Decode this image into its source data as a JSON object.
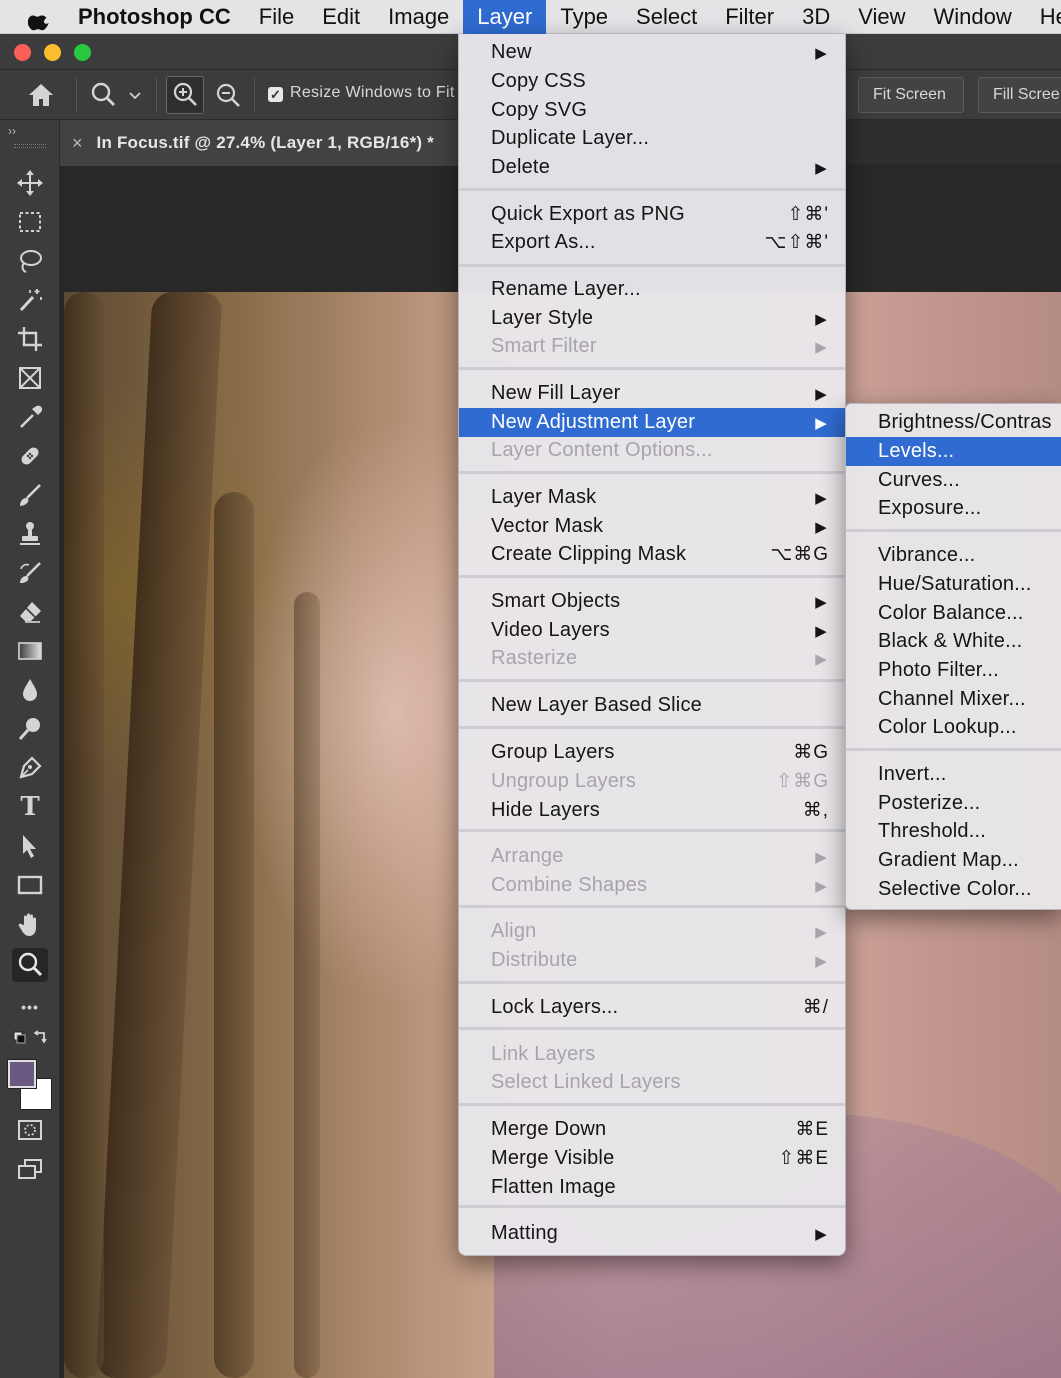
{
  "menubar": {
    "app": "Photoshop CC",
    "items": [
      "File",
      "Edit",
      "Image",
      "Layer",
      "Type",
      "Select",
      "Filter",
      "3D",
      "View",
      "Window",
      "He"
    ],
    "active": "Layer"
  },
  "options_bar": {
    "resize_label": "Resize Windows to Fit",
    "resize_checked": true,
    "fit_screen": "Fit Screen",
    "fill_screen": "Fill Scree"
  },
  "document": {
    "tab_title": "In Focus.tif @ 27.4% (Layer 1, RGB/16*) *",
    "close": "×"
  },
  "toolbar": {
    "collapse": "››",
    "type_glyph": "T",
    "more_glyph": "•••",
    "foreground_color": "#6a5a82",
    "background_color": "#ffffff"
  },
  "layer_menu": {
    "items": [
      {
        "label": "New",
        "shortcut": "",
        "submenu": true,
        "disabled": false
      },
      {
        "label": "Copy CSS",
        "shortcut": "",
        "submenu": false,
        "disabled": false
      },
      {
        "label": "Copy SVG",
        "shortcut": "",
        "submenu": false,
        "disabled": false
      },
      {
        "label": "Duplicate Layer...",
        "shortcut": "",
        "submenu": false,
        "disabled": false
      },
      {
        "label": "Delete",
        "shortcut": "",
        "submenu": true,
        "disabled": false
      },
      {
        "label": "Quick Export as PNG",
        "shortcut": "⇧⌘'",
        "submenu": false,
        "disabled": false
      },
      {
        "label": "Export As...",
        "shortcut": "⌥⇧⌘'",
        "submenu": false,
        "disabled": false
      },
      {
        "label": "Rename Layer...",
        "shortcut": "",
        "submenu": false,
        "disabled": false
      },
      {
        "label": "Layer Style",
        "shortcut": "",
        "submenu": true,
        "disabled": false
      },
      {
        "label": "Smart Filter",
        "shortcut": "",
        "submenu": true,
        "disabled": true
      },
      {
        "label": "New Fill Layer",
        "shortcut": "",
        "submenu": true,
        "disabled": false
      },
      {
        "label": "New Adjustment Layer",
        "shortcut": "",
        "submenu": true,
        "disabled": false,
        "highlighted": true
      },
      {
        "label": "Layer Content Options...",
        "shortcut": "",
        "submenu": false,
        "disabled": true
      },
      {
        "label": "Layer Mask",
        "shortcut": "",
        "submenu": true,
        "disabled": false
      },
      {
        "label": "Vector Mask",
        "shortcut": "",
        "submenu": true,
        "disabled": false
      },
      {
        "label": "Create Clipping Mask",
        "shortcut": "⌥⌘G",
        "submenu": false,
        "disabled": false
      },
      {
        "label": "Smart Objects",
        "shortcut": "",
        "submenu": true,
        "disabled": false
      },
      {
        "label": "Video Layers",
        "shortcut": "",
        "submenu": true,
        "disabled": false
      },
      {
        "label": "Rasterize",
        "shortcut": "",
        "submenu": true,
        "disabled": true
      },
      {
        "label": "New Layer Based Slice",
        "shortcut": "",
        "submenu": false,
        "disabled": false
      },
      {
        "label": "Group Layers",
        "shortcut": "⌘G",
        "submenu": false,
        "disabled": false
      },
      {
        "label": "Ungroup Layers",
        "shortcut": "⇧⌘G",
        "submenu": false,
        "disabled": true
      },
      {
        "label": "Hide Layers",
        "shortcut": "⌘,",
        "submenu": false,
        "disabled": false
      },
      {
        "label": "Arrange",
        "shortcut": "",
        "submenu": true,
        "disabled": true
      },
      {
        "label": "Combine Shapes",
        "shortcut": "",
        "submenu": true,
        "disabled": true
      },
      {
        "label": "Align",
        "shortcut": "",
        "submenu": true,
        "disabled": true
      },
      {
        "label": "Distribute",
        "shortcut": "",
        "submenu": true,
        "disabled": true
      },
      {
        "label": "Lock Layers...",
        "shortcut": "⌘/",
        "submenu": false,
        "disabled": false
      },
      {
        "label": "Link Layers",
        "shortcut": "",
        "submenu": false,
        "disabled": true
      },
      {
        "label": "Select Linked Layers",
        "shortcut": "",
        "submenu": false,
        "disabled": true
      },
      {
        "label": "Merge Down",
        "shortcut": "⌘E",
        "submenu": false,
        "disabled": false
      },
      {
        "label": "Merge Visible",
        "shortcut": "⇧⌘E",
        "submenu": false,
        "disabled": false
      },
      {
        "label": "Flatten Image",
        "shortcut": "",
        "submenu": false,
        "disabled": false
      },
      {
        "label": "Matting",
        "shortcut": "",
        "submenu": true,
        "disabled": false
      }
    ]
  },
  "adjustment_submenu": {
    "items": [
      {
        "label": "Brightness/Contras",
        "highlighted": false
      },
      {
        "label": "Levels...",
        "highlighted": true
      },
      {
        "label": "Curves...",
        "highlighted": false
      },
      {
        "label": "Exposure...",
        "highlighted": false
      },
      {
        "label": "Vibrance...",
        "highlighted": false
      },
      {
        "label": "Hue/Saturation...",
        "highlighted": false
      },
      {
        "label": "Color Balance...",
        "highlighted": false
      },
      {
        "label": "Black & White...",
        "highlighted": false
      },
      {
        "label": "Photo Filter...",
        "highlighted": false
      },
      {
        "label": "Channel Mixer...",
        "highlighted": false
      },
      {
        "label": "Color Lookup...",
        "highlighted": false
      },
      {
        "label": "Invert...",
        "highlighted": false
      },
      {
        "label": "Posterize...",
        "highlighted": false
      },
      {
        "label": "Threshold...",
        "highlighted": false
      },
      {
        "label": "Gradient Map...",
        "highlighted": false
      },
      {
        "label": "Selective Color...",
        "highlighted": false
      }
    ]
  }
}
